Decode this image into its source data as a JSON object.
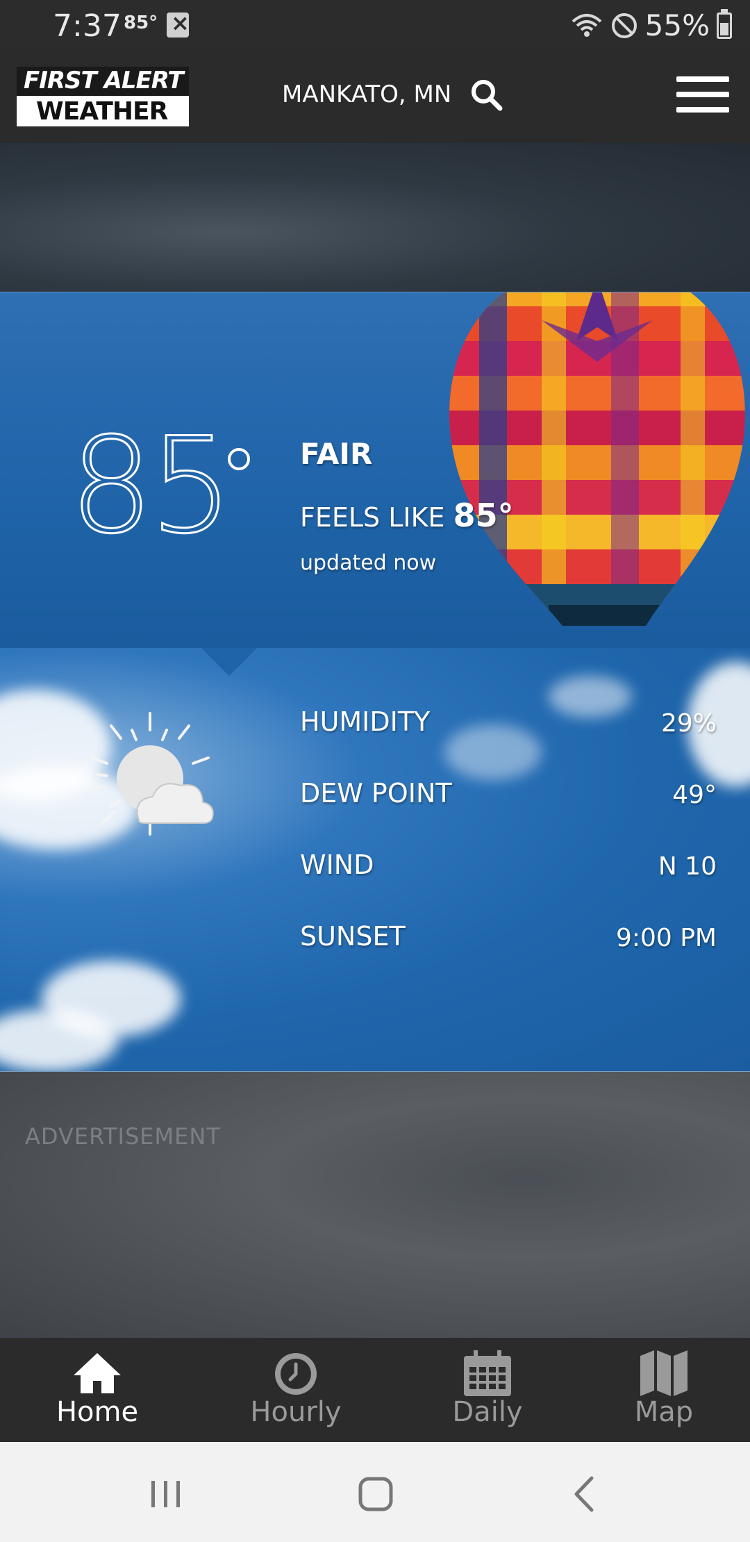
{
  "status_bar": {
    "time": "7:37",
    "temp": "85°",
    "battery": "55%"
  },
  "header": {
    "logo_top": "FIRST ALERT",
    "logo_bottom": "WEATHER",
    "location": "MANKATO, MN",
    "search_icon": "search-icon",
    "menu_icon": "hamburger-menu-icon"
  },
  "current": {
    "temperature": "85",
    "condition": "FAIR",
    "feels_like_label": "FEELS LIKE",
    "feels_like_value": "85°",
    "updated": "updated now"
  },
  "details": {
    "icon": "partly-sunny-icon",
    "rows": [
      {
        "label": "HUMIDITY",
        "value": "29%"
      },
      {
        "label": "DEW POINT",
        "value": "49°"
      },
      {
        "label": "WIND",
        "value": "N 10"
      },
      {
        "label": "SUNSET",
        "value": "9:00 PM"
      }
    ]
  },
  "ad": {
    "label": "ADVERTISEMENT"
  },
  "bottom_nav": {
    "items": [
      {
        "label": "Home",
        "icon": "home-icon",
        "active": true
      },
      {
        "label": "Hourly",
        "icon": "clock-icon",
        "active": false
      },
      {
        "label": "Daily",
        "icon": "calendar-icon",
        "active": false
      },
      {
        "label": "Map",
        "icon": "map-icon",
        "active": false
      }
    ]
  },
  "colors": {
    "header_bg": "#2b2b2b",
    "sky_blue": "#1f63a8",
    "nav_active": "#ffffff",
    "nav_inactive": "#9a9a9a"
  }
}
